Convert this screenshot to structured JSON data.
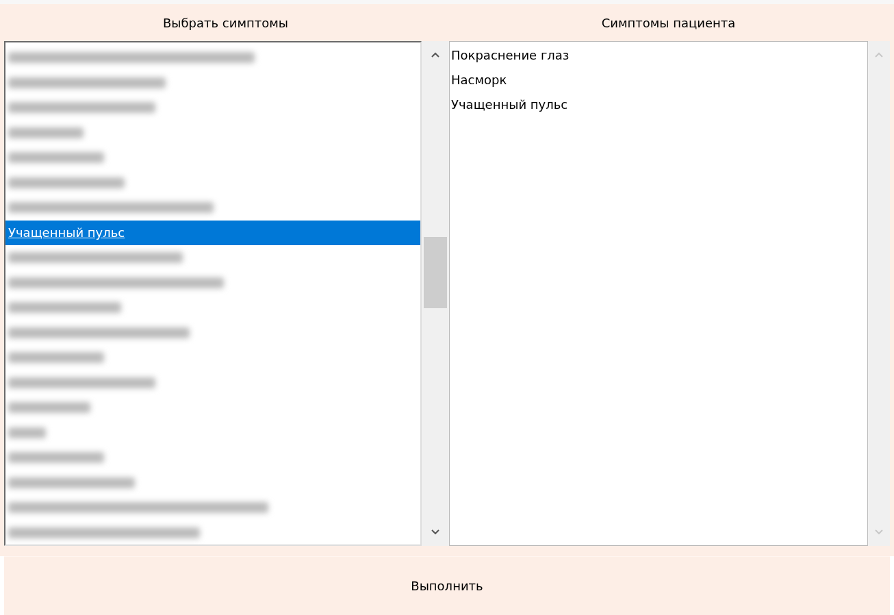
{
  "columns": [
    {
      "header": "Выбрать симптомы"
    },
    {
      "header": "Симптомы пациента"
    }
  ],
  "symptom_list": [
    {
      "blurred": true,
      "selected": false
    },
    {
      "blurred": true,
      "selected": false
    },
    {
      "blurred": true,
      "selected": false
    },
    {
      "blurred": true,
      "selected": false
    },
    {
      "blurred": true,
      "selected": false
    },
    {
      "blurred": true,
      "selected": false
    },
    {
      "blurred": true,
      "selected": false
    },
    {
      "blurred": false,
      "label": "Учащенный пульс",
      "selected": true
    },
    {
      "blurred": true,
      "selected": false
    },
    {
      "blurred": true,
      "selected": false
    },
    {
      "blurred": true,
      "selected": false
    },
    {
      "blurred": true,
      "selected": false
    },
    {
      "blurred": true,
      "selected": false
    },
    {
      "blurred": true,
      "selected": false
    },
    {
      "blurred": true,
      "selected": false
    },
    {
      "blurred": true,
      "selected": false
    },
    {
      "blurred": true,
      "selected": false
    },
    {
      "blurred": true,
      "selected": false
    },
    {
      "blurred": true,
      "selected": false
    },
    {
      "blurred": true,
      "selected": false
    }
  ],
  "patient_symptoms": [
    {
      "label": "Покраснение глаз"
    },
    {
      "label": "Насморк"
    },
    {
      "label": "Учащенный пульс"
    }
  ],
  "scrollbars": [
    {
      "disabled": false
    },
    {
      "disabled": true
    }
  ],
  "button": {
    "label": "Выполнить"
  }
}
